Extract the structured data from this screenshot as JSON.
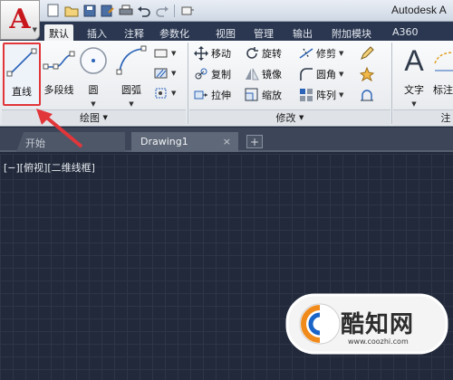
{
  "titlebar": {
    "app_title": "Autodesk A",
    "app_button_letter": "A",
    "quick_access": [
      "new-icon",
      "open-icon",
      "save-icon",
      "save-as-icon",
      "print-icon",
      "undo-icon",
      "redo-icon",
      "workspace-icon"
    ]
  },
  "ribbon_tabs": [
    "默认",
    "插入",
    "注释",
    "参数化",
    "视图",
    "管理",
    "输出",
    "附加模块",
    "A360"
  ],
  "active_tab": "默认",
  "draw_panel": {
    "title": "绘图",
    "line": "直线",
    "polyline": "多段线",
    "circle": "圆",
    "arc": "圆弧"
  },
  "modify_panel": {
    "title": "修改",
    "move": "移动",
    "rotate": "旋转",
    "trim": "修剪",
    "copy": "复制",
    "mirror": "镜像",
    "fillet": "圆角",
    "stretch": "拉伸",
    "scale": "缩放",
    "array": "阵列"
  },
  "annotation_panel": {
    "text": "文字",
    "dimension": "标注",
    "title_partial": "注"
  },
  "doc_tabs": {
    "start": "开始",
    "drawing": "Drawing1",
    "close": "×",
    "add": "+"
  },
  "viewport_label": "[−][俯视][二维线框]",
  "watermark": {
    "name": "酷知网",
    "url": "www.coozhi.com"
  },
  "colors": {
    "canvas": "#21293a",
    "highlight": "#e1363a",
    "app_red": "#c8161d"
  }
}
